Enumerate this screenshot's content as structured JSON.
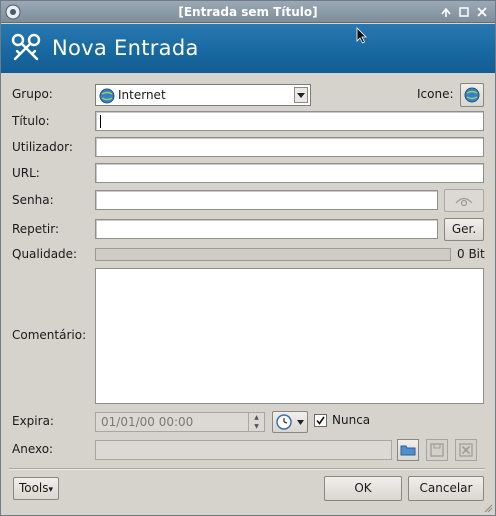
{
  "window": {
    "title": "[Entrada sem Título]"
  },
  "banner": {
    "title": "Nova Entrada"
  },
  "form": {
    "group_label": "Grupo:",
    "group_value": "Internet",
    "icon_label": "Icone:",
    "title_label": "Título:",
    "title_value": "",
    "user_label": "Utilizador:",
    "user_value": "",
    "url_label": "URL:",
    "url_value": "",
    "password_label": "Senha:",
    "password_value": "",
    "repeat_label": "Repetir:",
    "repeat_value": "",
    "generate_button": "Ger.",
    "quality_label": "Qualidade:",
    "quality_value": "0 Bit",
    "quality_fraction": 0,
    "comment_label": "Comentário:",
    "comment_value": "",
    "expires_label": "Expira:",
    "expires_value": "01/01/00 00:00",
    "never_label": "Nunca",
    "never_checked": true,
    "attachment_label": "Anexo:",
    "attachment_value": ""
  },
  "footer": {
    "tools_button": "Tools",
    "ok_button": "OK",
    "cancel_button": "Cancelar"
  },
  "colors": {
    "banner": "#1767a0",
    "titlebar": "#8c9ba8"
  },
  "icons": [
    "app-icon",
    "shield-icon",
    "minimize-icon",
    "maximize-icon",
    "close-icon",
    "keys-icon",
    "globe-icon",
    "eye-icon",
    "calendar-icon",
    "folder-icon",
    "save-icon",
    "delete-icon"
  ]
}
